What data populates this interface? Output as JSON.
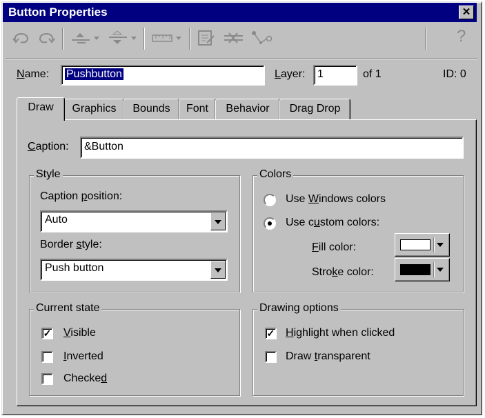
{
  "window": {
    "title": "Button Properties",
    "close_glyph": "✕"
  },
  "toolbar": {
    "help_glyph": "?",
    "icons": [
      "undo-icon",
      "redo-icon",
      "align-icon",
      "distribute-icon",
      "ruler-icon",
      "properties-icon",
      "connect-icon",
      "node-icon",
      "help-icon"
    ]
  },
  "header": {
    "name_label": "Name:",
    "name_value": "Pushbutton",
    "layer_label": "Layer:",
    "layer_value": "1",
    "layer_of": "of 1",
    "id_label": "ID: 0"
  },
  "tabs": [
    {
      "label": "Draw",
      "active": true
    },
    {
      "label": "Graphics",
      "active": false
    },
    {
      "label": "Bounds",
      "active": false
    },
    {
      "label": "Font",
      "active": false
    },
    {
      "label": "Behavior",
      "active": false
    },
    {
      "label": "Drag Drop",
      "active": false
    }
  ],
  "draw": {
    "caption_label": "Caption:",
    "caption_value": "&Button",
    "style": {
      "title": "Style",
      "caption_position_label": "Caption position:",
      "caption_position_value": "Auto",
      "border_style_label": "Border style:",
      "border_style_value": "Push button"
    },
    "colors": {
      "title": "Colors",
      "windows_colors_label": "Use Windows colors",
      "custom_colors_label": "Use custom colors:",
      "selected": "custom",
      "fill_label": "Fill color:",
      "fill_color": "#ffffff",
      "stroke_label": "Stroke color:",
      "stroke_color": "#000000"
    },
    "current_state": {
      "title": "Current state",
      "items": [
        {
          "label": "Visible",
          "checked": true
        },
        {
          "label": "Inverted",
          "checked": false
        },
        {
          "label": "Checked",
          "checked": false
        }
      ]
    },
    "drawing_options": {
      "title": "Drawing options",
      "items": [
        {
          "label": "Highlight when clicked",
          "checked": true
        },
        {
          "label": "Draw transparent",
          "checked": false
        }
      ]
    }
  },
  "colors": {
    "title_bar": "#000080",
    "face": "#c0c0c0",
    "selection": "#000080"
  },
  "check_glyph": "✓"
}
